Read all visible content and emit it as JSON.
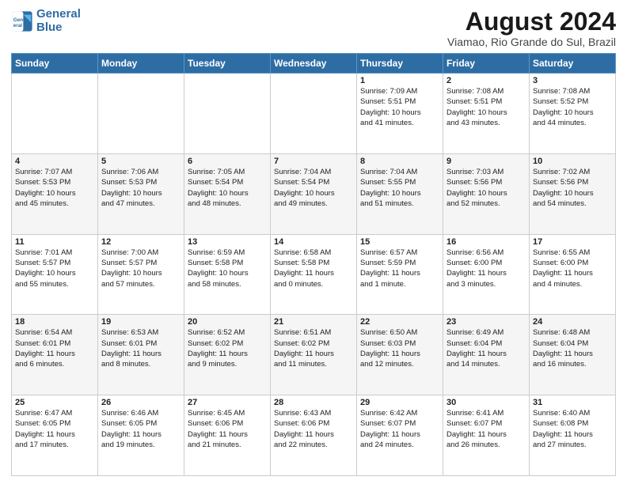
{
  "header": {
    "logo_line1": "General",
    "logo_line2": "Blue",
    "title": "August 2024",
    "subtitle": "Viamao, Rio Grande do Sul, Brazil"
  },
  "weekdays": [
    "Sunday",
    "Monday",
    "Tuesday",
    "Wednesday",
    "Thursday",
    "Friday",
    "Saturday"
  ],
  "weeks": [
    [
      {
        "day": "",
        "info": ""
      },
      {
        "day": "",
        "info": ""
      },
      {
        "day": "",
        "info": ""
      },
      {
        "day": "",
        "info": ""
      },
      {
        "day": "1",
        "info": "Sunrise: 7:09 AM\nSunset: 5:51 PM\nDaylight: 10 hours\nand 41 minutes."
      },
      {
        "day": "2",
        "info": "Sunrise: 7:08 AM\nSunset: 5:51 PM\nDaylight: 10 hours\nand 43 minutes."
      },
      {
        "day": "3",
        "info": "Sunrise: 7:08 AM\nSunset: 5:52 PM\nDaylight: 10 hours\nand 44 minutes."
      }
    ],
    [
      {
        "day": "4",
        "info": "Sunrise: 7:07 AM\nSunset: 5:53 PM\nDaylight: 10 hours\nand 45 minutes."
      },
      {
        "day": "5",
        "info": "Sunrise: 7:06 AM\nSunset: 5:53 PM\nDaylight: 10 hours\nand 47 minutes."
      },
      {
        "day": "6",
        "info": "Sunrise: 7:05 AM\nSunset: 5:54 PM\nDaylight: 10 hours\nand 48 minutes."
      },
      {
        "day": "7",
        "info": "Sunrise: 7:04 AM\nSunset: 5:54 PM\nDaylight: 10 hours\nand 49 minutes."
      },
      {
        "day": "8",
        "info": "Sunrise: 7:04 AM\nSunset: 5:55 PM\nDaylight: 10 hours\nand 51 minutes."
      },
      {
        "day": "9",
        "info": "Sunrise: 7:03 AM\nSunset: 5:56 PM\nDaylight: 10 hours\nand 52 minutes."
      },
      {
        "day": "10",
        "info": "Sunrise: 7:02 AM\nSunset: 5:56 PM\nDaylight: 10 hours\nand 54 minutes."
      }
    ],
    [
      {
        "day": "11",
        "info": "Sunrise: 7:01 AM\nSunset: 5:57 PM\nDaylight: 10 hours\nand 55 minutes."
      },
      {
        "day": "12",
        "info": "Sunrise: 7:00 AM\nSunset: 5:57 PM\nDaylight: 10 hours\nand 57 minutes."
      },
      {
        "day": "13",
        "info": "Sunrise: 6:59 AM\nSunset: 5:58 PM\nDaylight: 10 hours\nand 58 minutes."
      },
      {
        "day": "14",
        "info": "Sunrise: 6:58 AM\nSunset: 5:58 PM\nDaylight: 11 hours\nand 0 minutes."
      },
      {
        "day": "15",
        "info": "Sunrise: 6:57 AM\nSunset: 5:59 PM\nDaylight: 11 hours\nand 1 minute."
      },
      {
        "day": "16",
        "info": "Sunrise: 6:56 AM\nSunset: 6:00 PM\nDaylight: 11 hours\nand 3 minutes."
      },
      {
        "day": "17",
        "info": "Sunrise: 6:55 AM\nSunset: 6:00 PM\nDaylight: 11 hours\nand 4 minutes."
      }
    ],
    [
      {
        "day": "18",
        "info": "Sunrise: 6:54 AM\nSunset: 6:01 PM\nDaylight: 11 hours\nand 6 minutes."
      },
      {
        "day": "19",
        "info": "Sunrise: 6:53 AM\nSunset: 6:01 PM\nDaylight: 11 hours\nand 8 minutes."
      },
      {
        "day": "20",
        "info": "Sunrise: 6:52 AM\nSunset: 6:02 PM\nDaylight: 11 hours\nand 9 minutes."
      },
      {
        "day": "21",
        "info": "Sunrise: 6:51 AM\nSunset: 6:02 PM\nDaylight: 11 hours\nand 11 minutes."
      },
      {
        "day": "22",
        "info": "Sunrise: 6:50 AM\nSunset: 6:03 PM\nDaylight: 11 hours\nand 12 minutes."
      },
      {
        "day": "23",
        "info": "Sunrise: 6:49 AM\nSunset: 6:04 PM\nDaylight: 11 hours\nand 14 minutes."
      },
      {
        "day": "24",
        "info": "Sunrise: 6:48 AM\nSunset: 6:04 PM\nDaylight: 11 hours\nand 16 minutes."
      }
    ],
    [
      {
        "day": "25",
        "info": "Sunrise: 6:47 AM\nSunset: 6:05 PM\nDaylight: 11 hours\nand 17 minutes."
      },
      {
        "day": "26",
        "info": "Sunrise: 6:46 AM\nSunset: 6:05 PM\nDaylight: 11 hours\nand 19 minutes."
      },
      {
        "day": "27",
        "info": "Sunrise: 6:45 AM\nSunset: 6:06 PM\nDaylight: 11 hours\nand 21 minutes."
      },
      {
        "day": "28",
        "info": "Sunrise: 6:43 AM\nSunset: 6:06 PM\nDaylight: 11 hours\nand 22 minutes."
      },
      {
        "day": "29",
        "info": "Sunrise: 6:42 AM\nSunset: 6:07 PM\nDaylight: 11 hours\nand 24 minutes."
      },
      {
        "day": "30",
        "info": "Sunrise: 6:41 AM\nSunset: 6:07 PM\nDaylight: 11 hours\nand 26 minutes."
      },
      {
        "day": "31",
        "info": "Sunrise: 6:40 AM\nSunset: 6:08 PM\nDaylight: 11 hours\nand 27 minutes."
      }
    ]
  ]
}
